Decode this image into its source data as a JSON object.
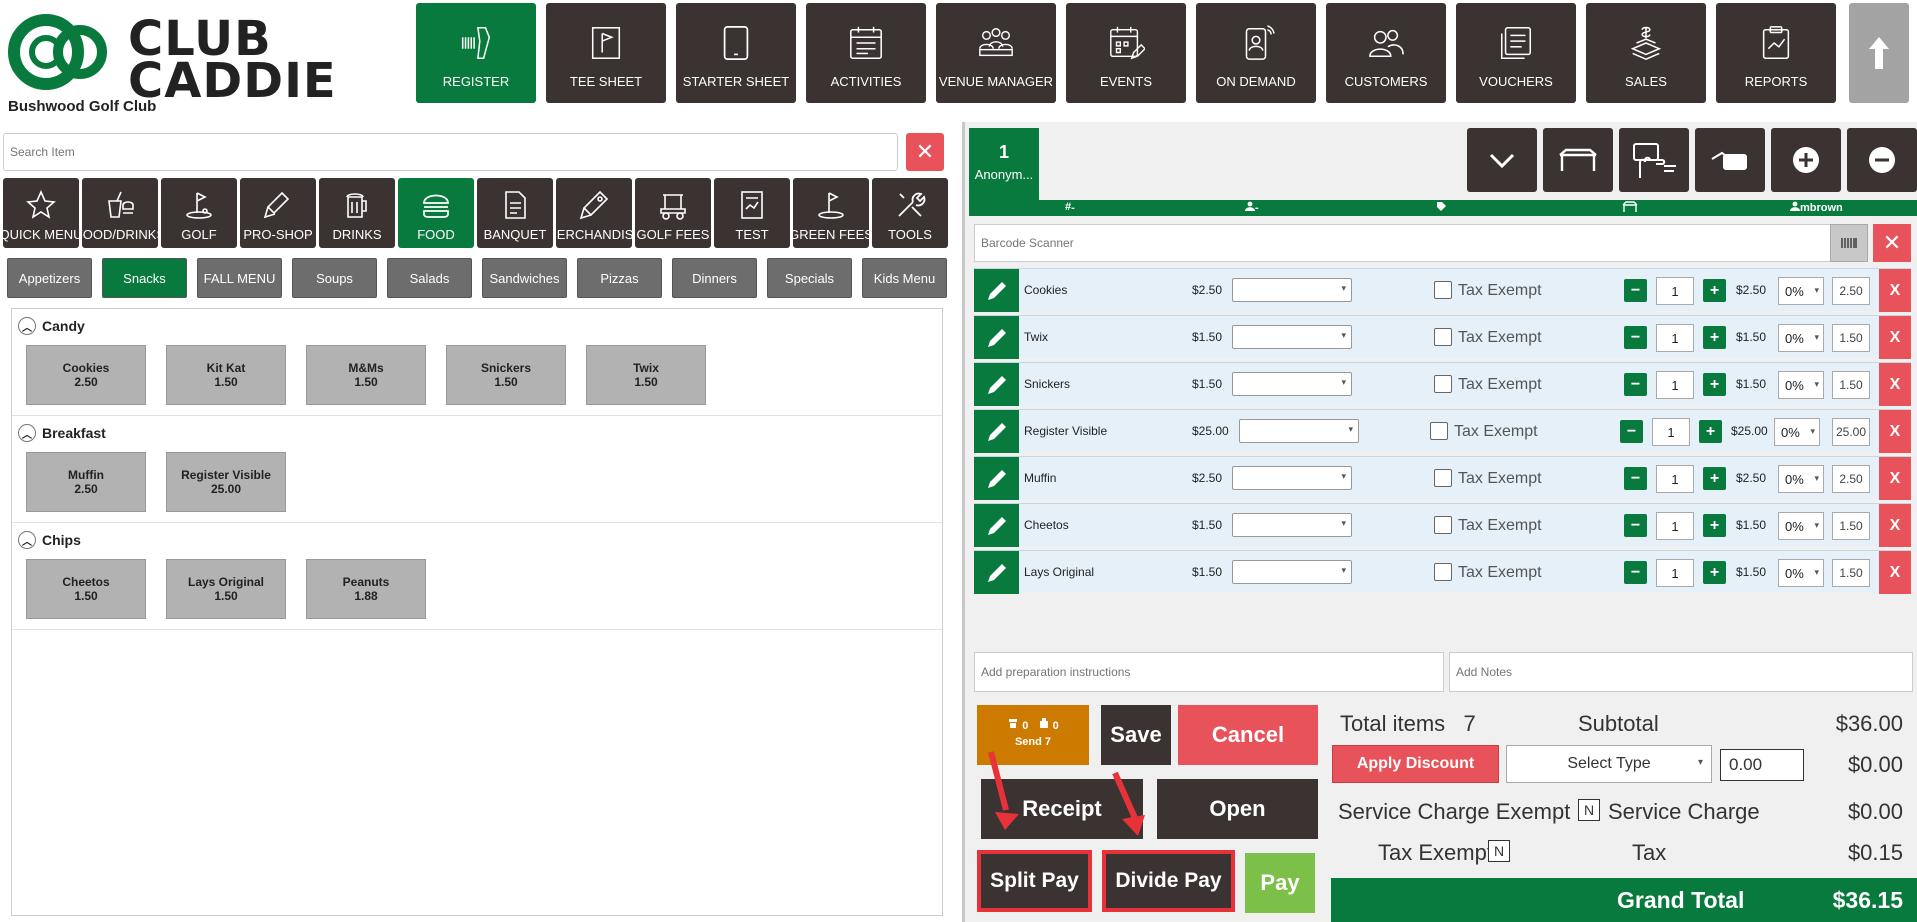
{
  "app": {
    "logo_text_line1": "CLUB",
    "logo_text_line2": "CADDIE",
    "club_name": "Bushwood Golf Club"
  },
  "colors": {
    "brand_green": "#097a3e",
    "dark_button": "#3a3331",
    "danger_red": "#e8525a",
    "send_orange": "#cc7a00",
    "pay_green": "#7cc04a",
    "highlight_red": "#e8323a"
  },
  "nav": {
    "items": [
      {
        "label": "REGISTER",
        "icon": "barcode-scanner-icon",
        "active": true
      },
      {
        "label": "TEE SHEET",
        "icon": "flag-icon"
      },
      {
        "label": "STARTER SHEET",
        "icon": "tablet-icon"
      },
      {
        "label": "ACTIVITIES",
        "icon": "calendar-icon"
      },
      {
        "label": "VENUE MANAGER",
        "icon": "people-table-icon"
      },
      {
        "label": "EVENTS",
        "icon": "calendar-edit-icon"
      },
      {
        "label": "ON DEMAND",
        "icon": "mobile-user-icon"
      },
      {
        "label": "CUSTOMERS",
        "icon": "users-icon"
      },
      {
        "label": "VOUCHERS",
        "icon": "voucher-icon"
      },
      {
        "label": "SALES",
        "icon": "money-icon"
      },
      {
        "label": "REPORTS",
        "icon": "report-icon"
      }
    ]
  },
  "search": {
    "placeholder": "Search Item"
  },
  "categories": [
    {
      "label": "QUICK MENU",
      "icon": "star-icon"
    },
    {
      "label": "FOOD/DRINKS",
      "icon": "food-drink-icon"
    },
    {
      "label": "GOLF",
      "icon": "golf-icon"
    },
    {
      "label": "PRO-SHOP",
      "icon": "pro-shop-icon"
    },
    {
      "label": "DRINKS",
      "icon": "beer-icon"
    },
    {
      "label": "FOOD",
      "icon": "burger-icon",
      "active": true
    },
    {
      "label": "BANQUET",
      "icon": "document-icon"
    },
    {
      "label": "MERCHANDISE",
      "icon": "merchandise-icon"
    },
    {
      "label": "GOLF FEES",
      "icon": "golf-cart-icon"
    },
    {
      "label": "TEST",
      "icon": "chart-doc-icon"
    },
    {
      "label": "GREEN FEES",
      "icon": "green-fees-icon"
    },
    {
      "label": "TOOLS",
      "icon": "tools-icon"
    }
  ],
  "subcategories": [
    {
      "label": "Appetizers"
    },
    {
      "label": "Snacks",
      "active": true
    },
    {
      "label": "FALL MENU"
    },
    {
      "label": "Soups"
    },
    {
      "label": "Salads"
    },
    {
      "label": "Sandwiches"
    },
    {
      "label": "Pizzas"
    },
    {
      "label": "Dinners"
    },
    {
      "label": "Specials"
    },
    {
      "label": "Kids Menu"
    }
  ],
  "groups": [
    {
      "name": "Candy",
      "items": [
        {
          "name": "Cookies",
          "price": "2.50"
        },
        {
          "name": "Kit Kat",
          "price": "1.50"
        },
        {
          "name": "M&Ms",
          "price": "1.50"
        },
        {
          "name": "Snickers",
          "price": "1.50"
        },
        {
          "name": "Twix",
          "price": "1.50"
        }
      ]
    },
    {
      "name": "Breakfast",
      "items": [
        {
          "name": "Muffin",
          "price": "2.50"
        },
        {
          "name": "Register Visible",
          "price": "25.00"
        }
      ]
    },
    {
      "name": "Chips",
      "items": [
        {
          "name": "Cheetos",
          "price": "1.50"
        },
        {
          "name": "Lays Original",
          "price": "1.50"
        },
        {
          "name": "Peanuts",
          "price": "1.88"
        }
      ]
    }
  ],
  "customer_tab": {
    "number": "1",
    "name": "Anonym..."
  },
  "info_bar": {
    "table": "-",
    "customer": "-",
    "user": "mbrown"
  },
  "barcode": {
    "placeholder": "Barcode Scanner"
  },
  "tax_exempt_label": "Tax Exempt",
  "line_items": [
    {
      "name": "Cookies",
      "price": "$2.50",
      "qty": "1",
      "ext_price": "$2.50",
      "discount": "0%",
      "total": "2.50"
    },
    {
      "name": "Twix",
      "price": "$1.50",
      "qty": "1",
      "ext_price": "$1.50",
      "discount": "0%",
      "total": "1.50"
    },
    {
      "name": "Snickers",
      "price": "$1.50",
      "qty": "1",
      "ext_price": "$1.50",
      "discount": "0%",
      "total": "1.50"
    },
    {
      "name": "Register Visible",
      "price": "$25.00",
      "qty": "1",
      "ext_price": "$25.00",
      "discount": "0%",
      "total": "25.00"
    },
    {
      "name": "Muffin",
      "price": "$2.50",
      "qty": "1",
      "ext_price": "$2.50",
      "discount": "0%",
      "total": "2.50"
    },
    {
      "name": "Cheetos",
      "price": "$1.50",
      "qty": "1",
      "ext_price": "$1.50",
      "discount": "0%",
      "total": "1.50"
    },
    {
      "name": "Lays Original",
      "price": "$1.50",
      "qty": "1",
      "ext_price": "$1.50",
      "discount": "0%",
      "total": "1.50"
    }
  ],
  "prep": {
    "placeholder": "Add preparation instructions"
  },
  "notes": {
    "placeholder": "Add Notes"
  },
  "actions": {
    "send_count_a": "0",
    "send_count_b": "0",
    "send_label": "Send 7",
    "save": "Save",
    "cancel": "Cancel",
    "receipt": "Receipt",
    "open": "Open",
    "split_pay": "Split Pay",
    "divide_pay": "Divide Pay",
    "pay": "Pay"
  },
  "totals": {
    "total_items_label": "Total items",
    "total_items": "7",
    "subtotal_label": "Subtotal",
    "subtotal": "$36.00",
    "apply_discount": "Apply Discount",
    "select_type": "Select Type",
    "discount_input": "0.00",
    "discount": "$0.00",
    "service_exempt_label": "Service Charge Exempt",
    "service_exempt_value": "N",
    "service_charge_label": "Service Charge",
    "service_charge": "$0.00",
    "tax_exempt_label": "Tax Exempt",
    "tax_exempt_value": "N",
    "tax_label": "Tax",
    "tax": "$0.15",
    "grand_total_label": "Grand Total",
    "grand_total": "$36.15"
  }
}
